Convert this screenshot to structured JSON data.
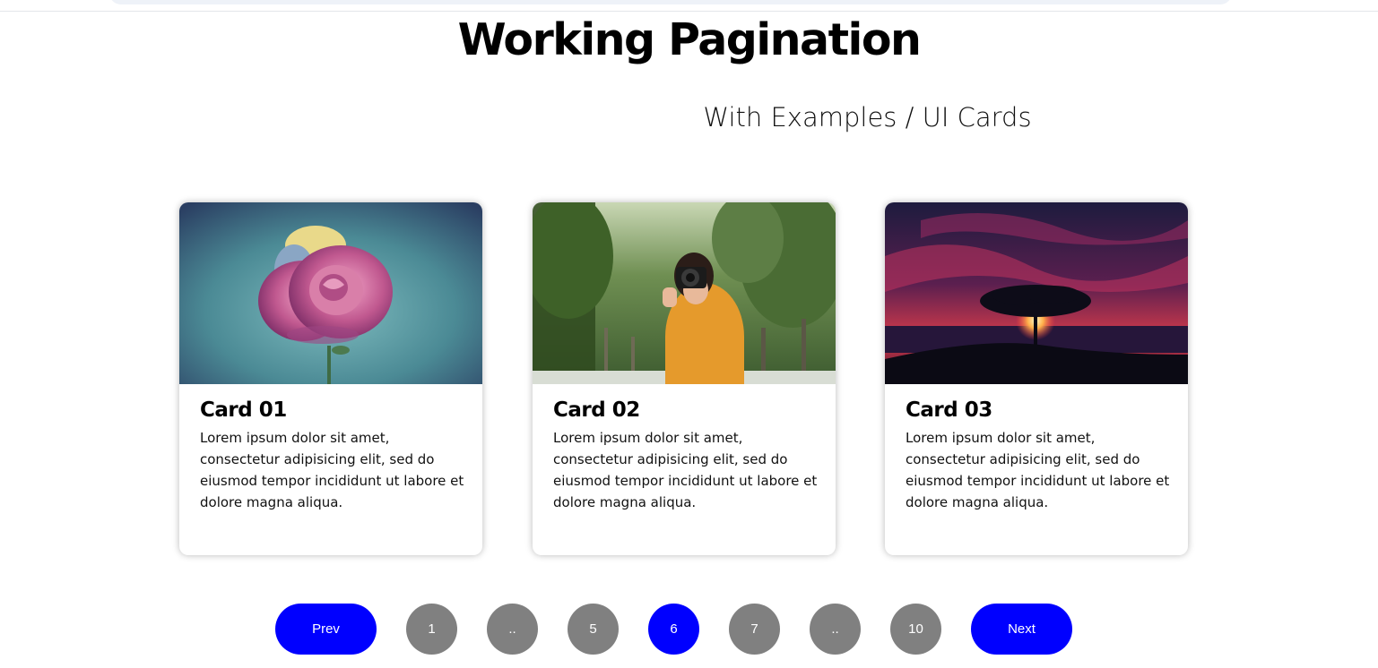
{
  "header": {
    "title": "Working Pagination",
    "subtitle": "With Examples / UI Cards"
  },
  "cards": [
    {
      "title": "Card 01",
      "text": "Lorem ipsum dolor sit amet, consectetur adipisicing elit, sed do eiusmod tempor incididunt ut labore et dolore magna aliqua.",
      "image": "pink-rose-photo"
    },
    {
      "title": "Card 02",
      "text": "Lorem ipsum dolor sit amet, consectetur adipisicing elit, sed do eiusmod tempor incididunt ut labore et dolore magna aliqua.",
      "image": "woman-with-camera-photo"
    },
    {
      "title": "Card 03",
      "text": "Lorem ipsum dolor sit amet, consectetur adipisicing elit, sed do eiusmod tempor incididunt ut labore et dolore magna aliqua.",
      "image": "tree-sunset-photo"
    }
  ],
  "pagination": {
    "prev_label": "Prev",
    "next_label": "Next",
    "pages": [
      "1",
      "..",
      "5",
      "6",
      "7",
      "..",
      "10"
    ],
    "current": "6"
  },
  "colors": {
    "accent": "#0000ff",
    "page_button": "#808080"
  }
}
